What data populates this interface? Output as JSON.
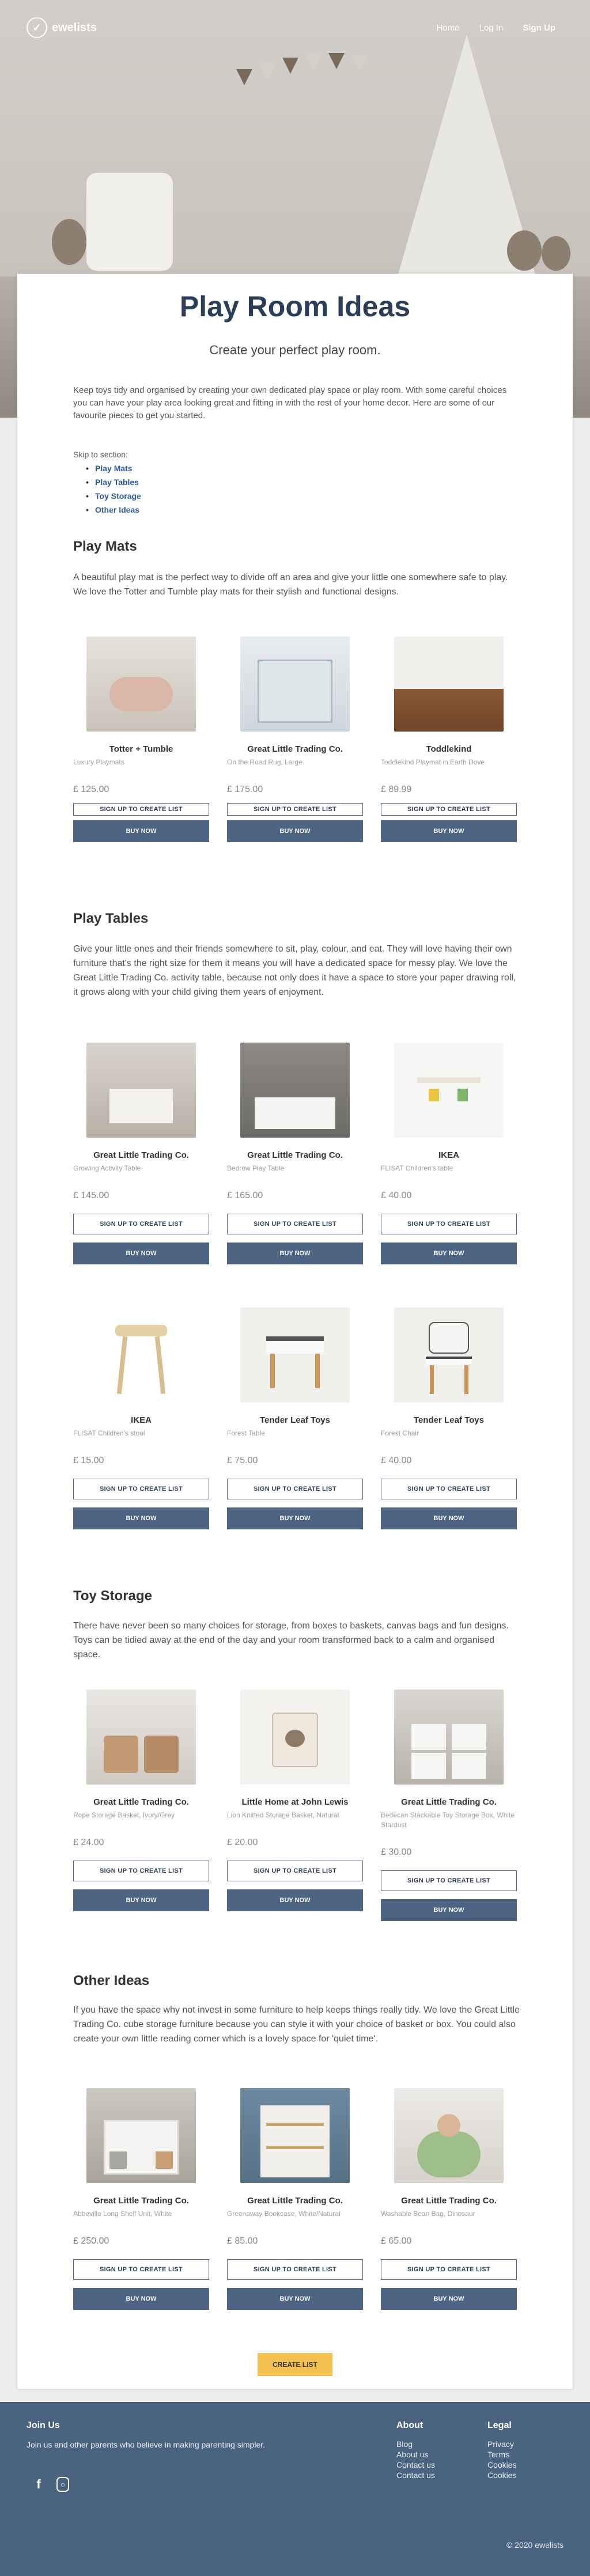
{
  "header": {
    "logo_text": "ewelists",
    "nav": [
      {
        "label": "Home"
      },
      {
        "label": "Log In"
      },
      {
        "label": "Sign Up"
      }
    ]
  },
  "page": {
    "title": "Play Room Ideas",
    "subtitle": "Create your perfect play room.",
    "intro": "Keep toys tidy and organised by creating your own dedicated play space or play room. With some careful choices you can have your play area looking great and fitting in with the rest of your home decor. Here are some of our favourite pieces to get you started.",
    "skip_label": "Skip to section:",
    "skip_links": [
      "Play Mats",
      "Play Tables",
      "Toy Storage",
      "Other Ideas"
    ]
  },
  "buttons": {
    "sign_up": "SIGN UP TO CREATE LIST",
    "buy_now": "BUY NOW",
    "create_list": "CREATE LIST"
  },
  "sections": [
    {
      "title": "Play Mats",
      "description": "A beautiful play mat is the perfect way to divide off an area and give your little one somewhere safe to play. We love the Totter and Tumble play mats for their stylish and functional designs.",
      "products": [
        {
          "brand": "Totter + Tumble",
          "name": "Luxury Playmats",
          "price": "£ 125.00"
        },
        {
          "brand": "Great Little Trading Co.",
          "name": "On the Road Rug, Large",
          "price": "£ 175.00"
        },
        {
          "brand": "Toddlekind",
          "name": "Toddlekind Playmat in Earth Dove",
          "price": "£ 89.99"
        }
      ]
    },
    {
      "title": "Play Tables",
      "description": "Give your little ones and their friends somewhere to sit, play, colour, and eat. They will love having their own furniture that's the right size for them it means you will have a dedicated space for messy play. We love the Great Little Trading Co. activity table, because not only does it have a space to store your paper drawing roll, it grows along with your child giving them years of enjoyment.",
      "products": [
        {
          "brand": "Great Little Trading Co.",
          "name": "Growing Activity Table",
          "price": "£ 145.00"
        },
        {
          "brand": "Great Little Trading Co.",
          "name": "Bedrow Play Table",
          "price": "£ 165.00"
        },
        {
          "brand": "IKEA",
          "name": "FLISAT Children's table",
          "price": "£ 40.00"
        },
        {
          "brand": "IKEA",
          "name": "FLISAT Children's stool",
          "price": "£ 15.00"
        },
        {
          "brand": "Tender Leaf Toys",
          "name": "Forest Table",
          "price": "£ 75.00"
        },
        {
          "brand": "Tender Leaf Toys",
          "name": "Forest Chair",
          "price": "£ 40.00"
        }
      ]
    },
    {
      "title": "Toy Storage",
      "description": "There have never been so many choices for storage, from boxes to baskets, canvas bags and fun designs. Toys can be tidied away at the end of the day and your room transformed back to a calm and organised space.",
      "products": [
        {
          "brand": "Great Little Trading Co.",
          "name": "Rope Storage Basket, Ivory/Grey",
          "price": "£ 24.00"
        },
        {
          "brand": "Little Home at John Lewis",
          "name": "Lion Knitted Storage Basket, Natural",
          "price": "£ 20.00"
        },
        {
          "brand": "Great Little Trading Co.",
          "name": "Bedecan Stackable Toy Storage Box, White Stardust",
          "price": "£ 30.00"
        }
      ]
    },
    {
      "title": "Other Ideas",
      "description": "If you have the space why not invest in some furniture to help keeps things really tidy. We love the Great Little Trading Co. cube storage furniture because you can style it with your choice of basket or box. You could also create your own little reading corner which is a lovely space for 'quiet time'.",
      "products": [
        {
          "brand": "Great Little Trading Co.",
          "name": "Abbeville Long Shelf Unit, White",
          "price": "£ 250.00"
        },
        {
          "brand": "Great Little Trading Co.",
          "name": "Greenaway Bookcase, White/Natural",
          "price": "£ 85.00"
        },
        {
          "brand": "Great Little Trading Co.",
          "name": "Washable Bean Bag, Dinosaur",
          "price": "£ 65.00"
        }
      ]
    }
  ],
  "footer": {
    "join_title": "Join Us",
    "join_text": "Join us and other parents who believe in making parenting simpler.",
    "about_title": "About",
    "about_links": [
      "Blog",
      "About us",
      "Contact us",
      "Contact us"
    ],
    "legal_title": "Legal",
    "legal_links": [
      "Privacy",
      "Terms",
      "Cookies",
      "Cookies"
    ],
    "copyright": "© 2020 ewelists"
  },
  "colors": {
    "accent": "#4d6582",
    "create_list": "#f4c04f",
    "footer_bg": "#4a6380",
    "title": "#2c3e55"
  }
}
